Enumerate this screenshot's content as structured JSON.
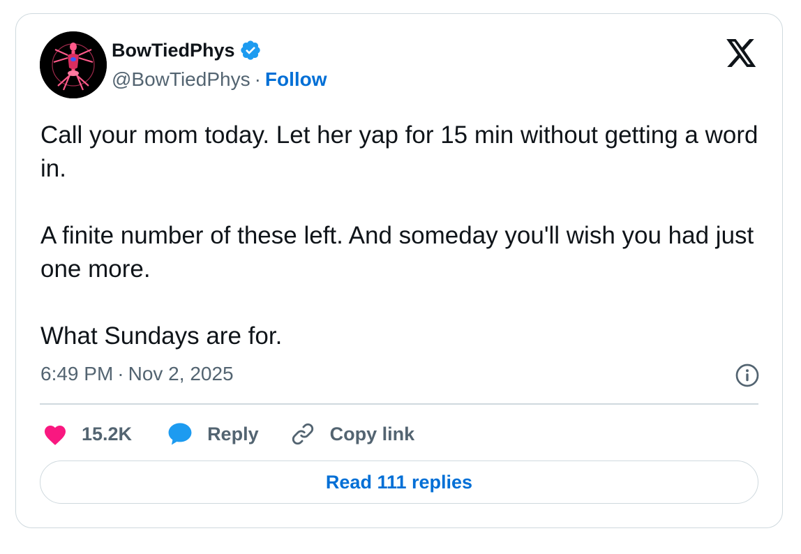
{
  "author": {
    "display_name": "BowTiedPhys",
    "handle": "@BowTiedPhys",
    "separator": "·",
    "follow_label": "Follow",
    "verified": true,
    "verified_icon": "verified-badge-icon"
  },
  "tweet": {
    "paragraphs": [
      "Call your mom today. Let her yap for 15 min without getting a word in.",
      "A finite number of these left. And someday you'll wish you had just one more.",
      "What Sundays are for."
    ],
    "time": "6:49 PM",
    "separator": "·",
    "date": "Nov 2, 2025"
  },
  "actions": {
    "likes": "15.2K",
    "reply_label": "Reply",
    "copy_link_label": "Copy link"
  },
  "read_replies_label": "Read 111 replies",
  "icons": {
    "platform_logo": "x-logo-icon",
    "info": "info-icon",
    "like": "heart-icon",
    "reply": "speech-bubble-icon",
    "copy": "link-icon"
  },
  "colors": {
    "link_blue": "#006fd6",
    "verified_blue": "#1d9bf0",
    "heart_pink": "#f91880",
    "secondary_text": "#536471",
    "border": "#cfd9de"
  }
}
